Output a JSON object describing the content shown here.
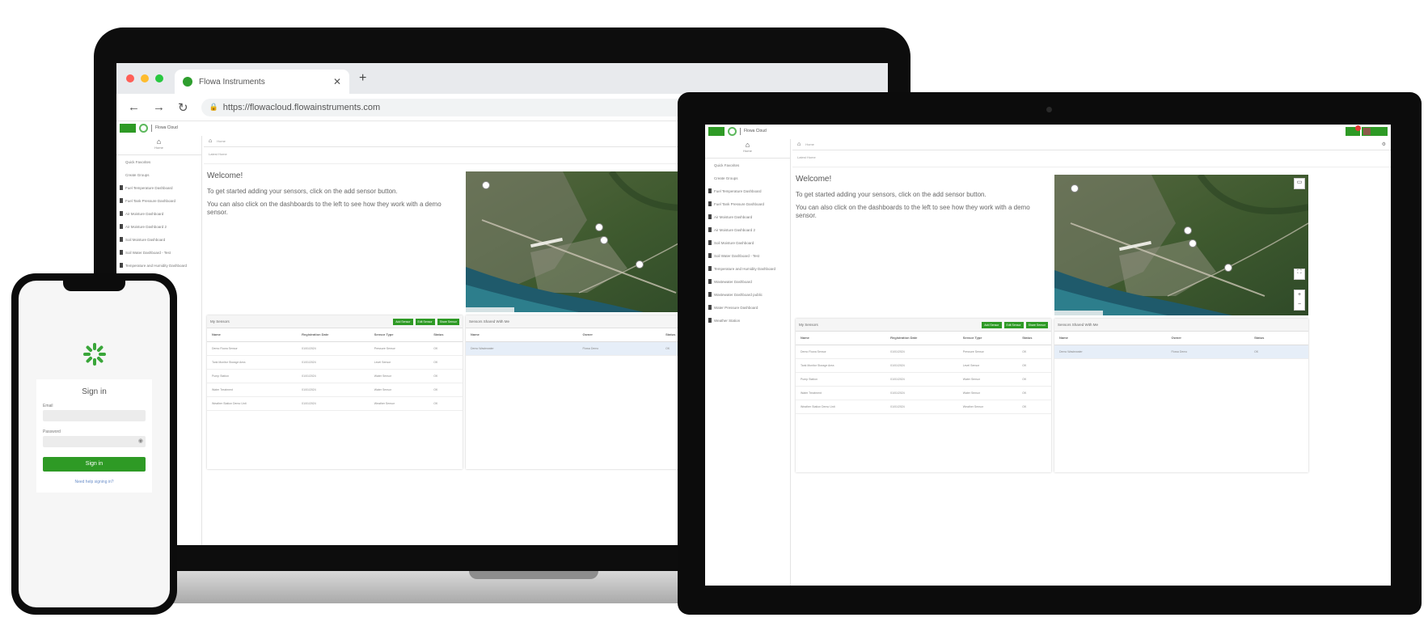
{
  "colors": {
    "brand_green": "#2e9a25",
    "selection_blue": "#e6eef8",
    "device_black": "#0c0c0c"
  },
  "browser": {
    "tab_title": "Flowa Instruments",
    "url": "https://flowacloud.flowainstruments.com"
  },
  "app": {
    "brand_text": "Flowa Cloud",
    "sidebar_head_label": "Home",
    "sidebar_items": [
      "Quick Favorites",
      "Create Groups",
      "Fuel Temperature Dashboard",
      "Fuel Tank Pressure Dashboard",
      "Air Moisture Dashboard",
      "Air Moisture Dashboard 2",
      "Soil Moisture Dashboard",
      "Soil Water Dashboard - Test",
      "Temperature and Humidity Dashboard",
      "Wastewater Dashboard",
      "Wastewater Dashboard public",
      "Water Pressure Dashboard",
      "Weather Station"
    ],
    "toolbar_text": "Home",
    "breadcrumb": "Latest Home",
    "welcome": {
      "title": "Welcome!",
      "line1": "To get started adding your sensors, click on the add sensor button.",
      "line2": "You can also click on the dashboards to the left to see how they work with a demo sensor."
    },
    "sensors_panel": {
      "title": "My Sensors",
      "buttons": [
        "Add Sensor",
        "Edit Sensor",
        "Share Sensor"
      ],
      "columns": [
        "Name",
        "Registration Date",
        "Sensor Type",
        "Status"
      ],
      "rows": [
        [
          "Demo Flowa Sensor",
          "01/01/2024",
          "Pressure Sensor",
          "OK"
        ],
        [
          "Tank Monitor Storage Area",
          "01/01/2024",
          "Level Sensor",
          "OK"
        ],
        [
          "Pump Station",
          "01/01/2024",
          "Water Sensor",
          "OK"
        ],
        [
          "Water Treatment",
          "01/01/2024",
          "Water Sensor",
          "OK"
        ],
        [
          "Weather Station Demo Unit",
          "01/01/2024",
          "Weather Sensor",
          "OK"
        ]
      ]
    },
    "shared_panel": {
      "title": "Sensors Shared With Me",
      "columns": [
        "Name",
        "Owner",
        "Status"
      ],
      "rows": [
        [
          "Demo Wastewater",
          "Flowa Demo",
          "OK"
        ]
      ]
    }
  },
  "phone": {
    "signin_title": "Sign in",
    "email_label": "Email",
    "password_label": "Password",
    "signin_button": "Sign in",
    "forgot_link": "Need help signing in?"
  }
}
